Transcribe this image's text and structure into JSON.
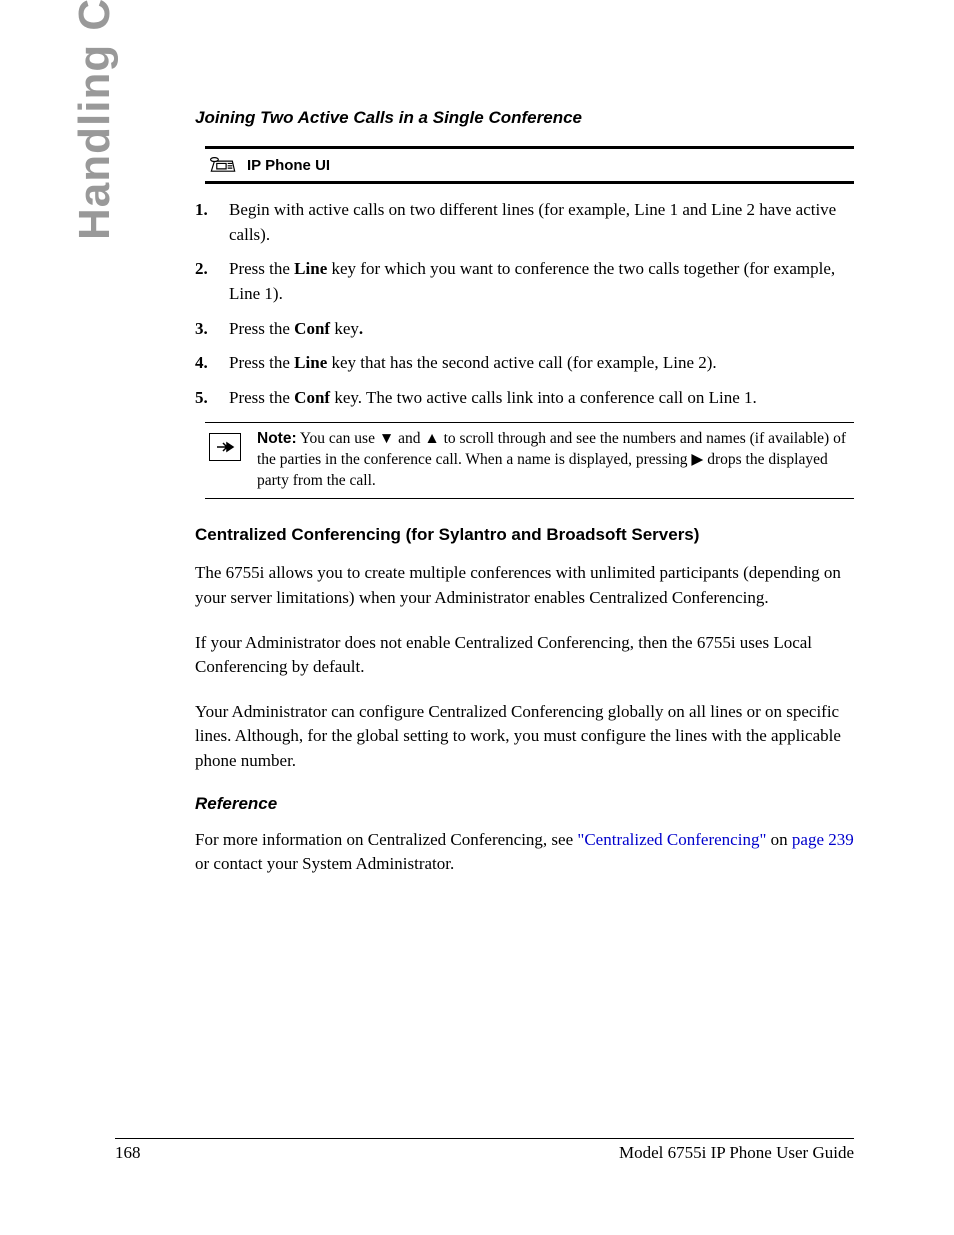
{
  "side_heading": "Handling Calls",
  "section_title": "Joining Two Active Calls in a Single Conference",
  "ui_banner_label": "IP Phone UI",
  "steps": {
    "s1a": "Begin with active calls on two different lines (for example, Line 1 and Line 2 have active calls).",
    "s2a": "Press the ",
    "s2b": "Line",
    "s2c": " key for which you want to conference the two calls together (for example, Line 1).",
    "s3a": "Press the ",
    "s3b": "Conf",
    "s3c": " key",
    "s3d": ".",
    "s4a": "Press the ",
    "s4b": "Line",
    "s4c": " key that has the second active call (for example, Line 2).",
    "s5a": "Press the ",
    "s5b": "Conf",
    "s5c": " key. The two active calls link into a conference call on Line 1."
  },
  "note": {
    "label": "Note:",
    "t1": " You can use ",
    "sym_down": "▼",
    "t2": " and ",
    "sym_up": "▲",
    "t3": " to scroll through and see the numbers and names (if available) of the parties in the conference call. When a name is displayed, pressing ",
    "sym_right": "▶",
    "t4": " drops the displayed party from the call."
  },
  "subhead": "Centralized Conferencing (for Sylantro and Broadsoft Servers)",
  "para1": "The 6755i allows you to create multiple conferences with unlimited participants (depending on your server limitations) when your Administrator enables Centralized Conferencing.",
  "para2": "If your Administrator does not enable Centralized Conferencing, then the 6755i uses Local Conferencing by default.",
  "para3": "Your Administrator can configure Centralized Conferencing globally on all lines or on specific lines. Although, for the global setting to work, you must configure the lines with the applicable phone number.",
  "ref_title": "Reference",
  "ref": {
    "t1": "For more information on Centralized Conferencing, see ",
    "link1": "\"Centralized Conferencing\"",
    "t2": " on ",
    "link2": "page 239",
    "t3": " or contact your System Administrator."
  },
  "footer": {
    "page": "168",
    "doc": "Model 6755i IP Phone User Guide"
  }
}
